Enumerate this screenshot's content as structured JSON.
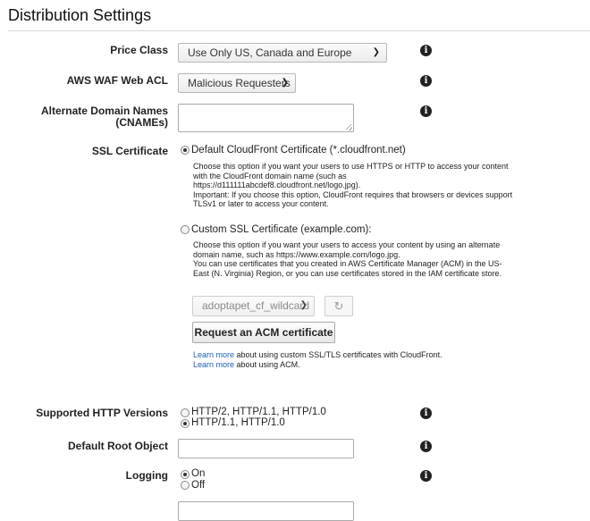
{
  "page": {
    "title": "Distribution Settings"
  },
  "price_class": {
    "label": "Price Class",
    "value": "Use Only US, Canada and Europe"
  },
  "waf": {
    "label": "AWS WAF Web ACL",
    "value": "Malicious Requesters"
  },
  "cnames": {
    "label_line1": "Alternate Domain Names",
    "label_line2": "(CNAMEs)",
    "value": ""
  },
  "ssl": {
    "label": "SSL Certificate",
    "default_option": "Default CloudFront Certificate (*.cloudfront.net)",
    "default_desc": [
      "Choose this option if you want your users to use HTTPS or HTTP to access your content",
      "with the CloudFront domain name (such as",
      "https://d111111abcdef8.cloudfront.net/logo.jpg).",
      "Important: If you choose this option, CloudFront requires that browsers or devices support",
      "TLSv1 or later to access your content."
    ],
    "custom_option": "Custom SSL Certificate (example.com):",
    "custom_desc": [
      "Choose this option if you want your users to access your content by using an alternate",
      "domain name, such as https://www.example.com/logo.jpg.",
      "You can use certificates that you created in AWS Certificate Manager (ACM) in the US-",
      "East (N. Virginia) Region, or you can use certificates stored in the IAM certificate store."
    ],
    "cert_select": "adoptapet_cf_wildcard",
    "request_button": "Request an ACM certificate",
    "learn_more_link": "Learn more",
    "learn_line1_rest": " about using custom SSL/TLS certificates with CloudFront.",
    "learn_line2_rest": " about using ACM."
  },
  "http_versions": {
    "label": "Supported HTTP Versions",
    "option1": "HTTP/2, HTTP/1.1, HTTP/1.0",
    "option2": "HTTP/1.1, HTTP/1.0"
  },
  "root_object": {
    "label": "Default Root Object",
    "value": ""
  },
  "logging": {
    "label": "Logging",
    "on": "On",
    "off": "Off"
  }
}
